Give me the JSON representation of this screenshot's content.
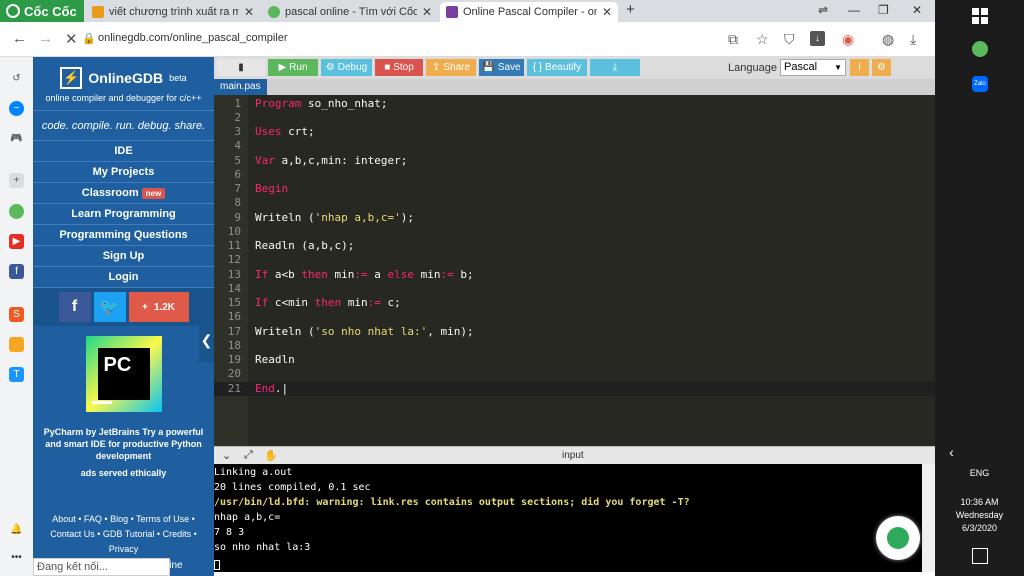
{
  "browser": {
    "brand": "Cốc Cốc",
    "tabs": [
      {
        "title": "viết chương trình xuất ra màn",
        "icon": "h-icon",
        "color": "#e89a1c"
      },
      {
        "title": "pascal online - Tìm với Cốc Cốc",
        "icon": "coccoc-icon",
        "color": "#5cb85c"
      },
      {
        "title": "Online Pascal Compiler - onlinegdb",
        "icon": "onlinegdb-icon",
        "color": "#7b3fa0"
      }
    ],
    "new_tab": "+",
    "url": "onlinegdb.com/online_pascal_compiler"
  },
  "gdb": {
    "name": "OnlineGDB",
    "beta": "beta",
    "subtitle": "online compiler and debugger for c/c++",
    "tagline": "code. compile. run. debug. share.",
    "menu": [
      "IDE",
      "My Projects",
      "Classroom",
      "Learn Programming",
      "Programming Questions",
      "Sign Up",
      "Login"
    ],
    "new_badge": "new",
    "share_count": "1.2K",
    "ad": {
      "logo_text": "PC",
      "text": "PyCharm by JetBrains Try a powerful and smart IDE for productive Python development",
      "ethical": "ads served ethically"
    },
    "footer": [
      "About • FAQ • Blog • Terms of Use •",
      "Contact Us • GDB Tutorial • Credits •",
      "Privacy"
    ],
    "footer_tail": "line"
  },
  "toolbar": {
    "run": "Run",
    "debug": "Debug",
    "stop": "Stop",
    "share": "Share",
    "save": "Save",
    "beautify": "{ } Beautify",
    "language_label": "Language",
    "language": "Pascal"
  },
  "file_tab": "main.pas",
  "editor": {
    "line_numbers": [
      "1",
      "2",
      "3",
      "4",
      "5",
      "6",
      "7",
      "8",
      "9",
      "10",
      "11",
      "12",
      "13",
      "14",
      "15",
      "16",
      "17",
      "18",
      "19",
      "20",
      "21"
    ]
  },
  "io": {
    "label": "input",
    "lines": [
      "Linking a.out",
      "20 lines compiled, 0.1 sec",
      "/usr/bin/ld.bfd: warning: link.res contains output sections; did you forget -T?",
      "nhap a,b,c=",
      "7 8 3",
      "so nho nhat la:3"
    ]
  },
  "status": "Đang kết nối...",
  "taskbar": {
    "lang": "ENG",
    "time": "10:36 AM",
    "day": "Wednesday",
    "date": "6/3/2020",
    "zalo": "Zalo"
  }
}
